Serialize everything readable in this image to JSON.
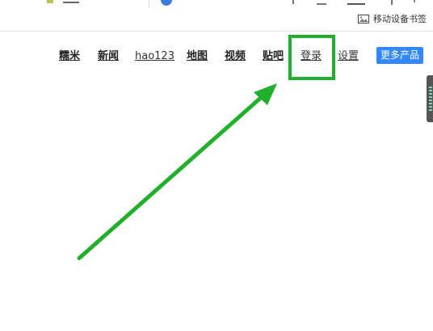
{
  "bookmark": {
    "label": "移动设备书签",
    "icon": "mobile-bookmark-icon"
  },
  "nav": {
    "items": [
      {
        "label": "糯米"
      },
      {
        "label": "新闻"
      },
      {
        "label": "hao123"
      },
      {
        "label": "地图"
      },
      {
        "label": "视频"
      },
      {
        "label": "贴吧"
      },
      {
        "label": "登录"
      },
      {
        "label": "设置"
      }
    ],
    "more_button": "更多产品"
  },
  "colors": {
    "annotation_green": "#22b02c",
    "more_button_bg": "#3388ff"
  }
}
